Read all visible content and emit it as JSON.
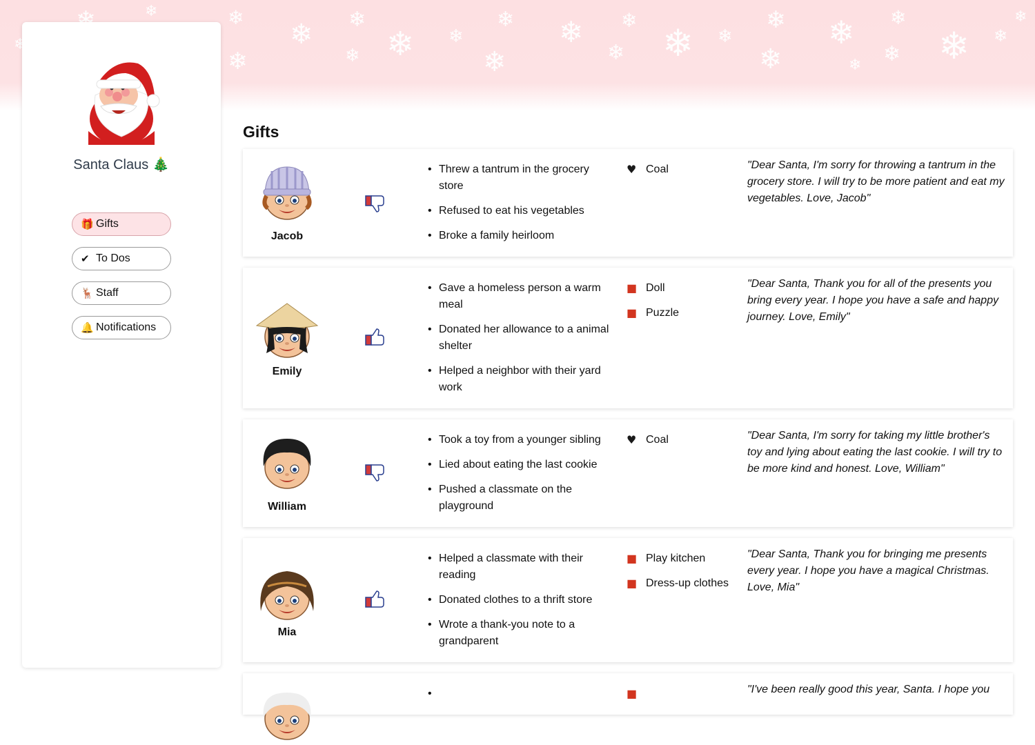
{
  "banner": {
    "flake_glyph": "❄"
  },
  "sidebar": {
    "profile_name": "Santa Claus 🎄",
    "avatar_icon": "santa-avatar-icon",
    "nav": [
      {
        "icon": "🎁",
        "label": "Gifts",
        "active": true
      },
      {
        "icon": "✔",
        "label": "To Dos",
        "active": false
      },
      {
        "icon": "🦌",
        "label": "Staff",
        "active": false
      },
      {
        "icon": "🔔",
        "label": "Notifications",
        "active": false
      }
    ]
  },
  "main": {
    "title": "Gifts",
    "children": [
      {
        "name": "Jacob",
        "avatar": "boy-beanie-avatar-icon",
        "verdict": "thumbs-down",
        "deeds": [
          "Threw a tantrum in the grocery store",
          "Refused to eat his vegetables",
          "Broke a family heirloom"
        ],
        "gifts": [
          {
            "icon": "coal-icon",
            "label": "Coal"
          }
        ],
        "letter": "\"Dear Santa, I'm sorry for throwing a tantrum in the grocery store. I will try to be more patient and eat my vegetables. Love, Jacob\""
      },
      {
        "name": "Emily",
        "avatar": "girl-hat-avatar-icon",
        "verdict": "thumbs-up",
        "deeds": [
          "Gave a homeless person a warm meal",
          "Donated her allowance to a animal shelter",
          "Helped a neighbor with their yard work"
        ],
        "gifts": [
          {
            "icon": "present-icon",
            "label": "Doll"
          },
          {
            "icon": "present-icon",
            "label": "Puzzle"
          }
        ],
        "letter": "\"Dear Santa, Thank you for all of the presents you bring every year. I hope you have a safe and happy journey. Love, Emily\""
      },
      {
        "name": "William",
        "avatar": "boy-avatar-icon",
        "verdict": "thumbs-down",
        "deeds": [
          "Took a toy from a younger sibling",
          "Lied about eating the last cookie",
          "Pushed a classmate on the playground"
        ],
        "gifts": [
          {
            "icon": "coal-icon",
            "label": "Coal"
          }
        ],
        "letter": "\"Dear Santa, I'm sorry for taking my little brother's toy and lying about eating the last cookie. I will try to be more kind and honest. Love, William\""
      },
      {
        "name": "Mia",
        "avatar": "girl-avatar-icon",
        "verdict": "thumbs-up",
        "deeds": [
          "Helped a classmate with their reading",
          "Donated clothes to a thrift store",
          "Wrote a thank-you note to a grandparent"
        ],
        "gifts": [
          {
            "icon": "present-icon",
            "label": "Play kitchen"
          },
          {
            "icon": "present-icon",
            "label": "Dress-up clothes"
          }
        ],
        "letter": "\"Dear Santa, Thank you for bringing me presents every year. I hope you have a magical Christmas. Love, Mia\""
      },
      {
        "name": "",
        "avatar": "child-avatar-icon",
        "verdict": "",
        "deeds": [
          ""
        ],
        "gifts": [
          {
            "icon": "present-icon",
            "label": ""
          }
        ],
        "letter": "\"I've been really good this year, Santa. I hope you"
      }
    ]
  }
}
